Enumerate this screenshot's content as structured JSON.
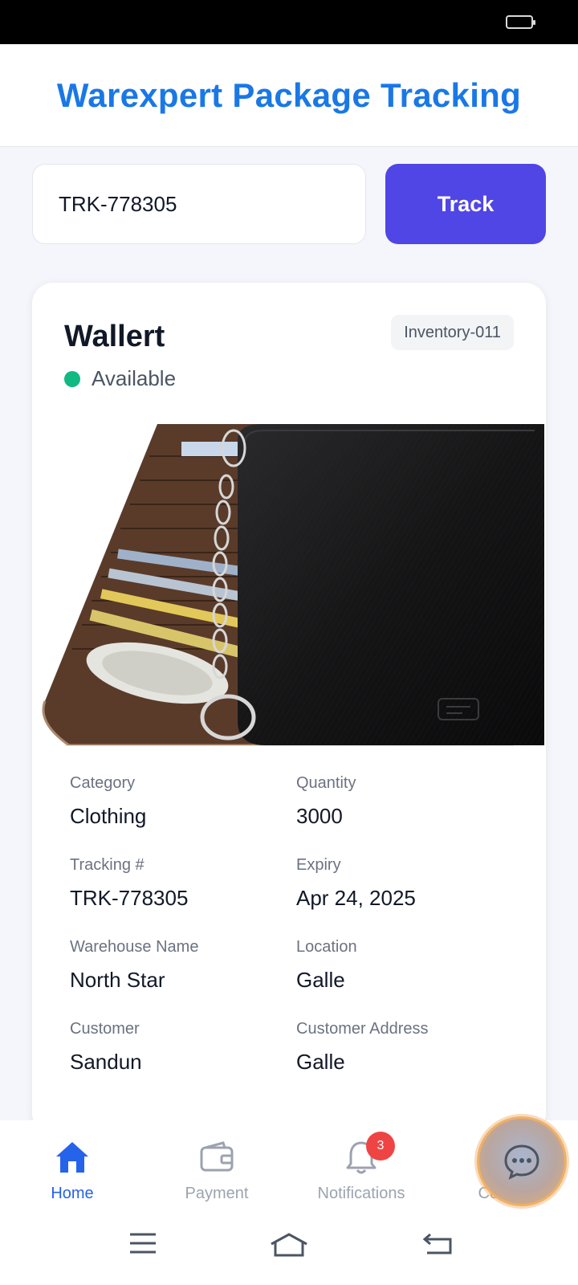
{
  "header": {
    "title": "Warexpert Package Tracking"
  },
  "search": {
    "value": "TRK-778305",
    "button_label": "Track"
  },
  "item": {
    "name": "Wallert",
    "inventory_id": "Inventory-011",
    "status": "Available",
    "status_color": "#10b981",
    "image_label": "product-image-wallet",
    "details": [
      {
        "label": "Category",
        "value": "Clothing"
      },
      {
        "label": "Quantity",
        "value": "3000"
      },
      {
        "label": "Tracking #",
        "value": "TRK-778305"
      },
      {
        "label": "Expiry",
        "value": "Apr 24, 2025"
      },
      {
        "label": "Warehouse Name",
        "value": "North Star"
      },
      {
        "label": "Location",
        "value": "Galle"
      },
      {
        "label": "Customer",
        "value": "Sandun"
      },
      {
        "label": "Customer Address",
        "value": "Galle"
      }
    ]
  },
  "nav": {
    "items": [
      {
        "label": "Home",
        "icon": "home-icon",
        "active": true
      },
      {
        "label": "Payment",
        "icon": "wallet-icon"
      },
      {
        "label": "Notifications",
        "icon": "bell-icon",
        "badge": "3"
      },
      {
        "label": "Contact",
        "icon": "chat-icon"
      }
    ]
  },
  "colors": {
    "accent": "#1a78e6",
    "primary_button": "#5046e5",
    "active_nav": "#2563eb",
    "badge": "#ef4444"
  }
}
